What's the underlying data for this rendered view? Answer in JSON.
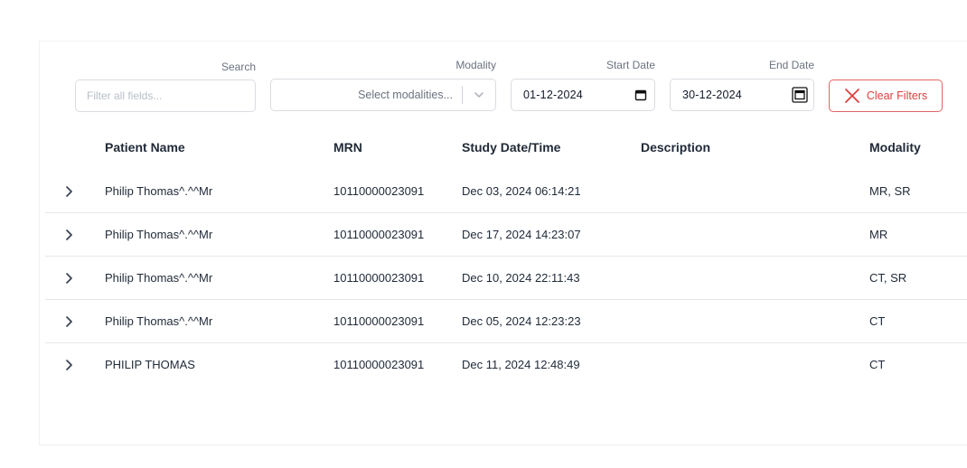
{
  "filters": {
    "search": {
      "label": "Search",
      "placeholder": "Filter all fields...",
      "value": ""
    },
    "modality": {
      "label": "Modality",
      "placeholder": "Select modalities..."
    },
    "start_date": {
      "label": "Start Date",
      "value": "01-12-2024"
    },
    "end_date": {
      "label": "End Date",
      "value": "30-12-2024"
    },
    "clear_label": "Clear Filters"
  },
  "table": {
    "columns": {
      "patient_name": "Patient Name",
      "mrn": "MRN",
      "study_datetime": "Study Date/Time",
      "description": "Description",
      "modality": "Modality"
    },
    "rows": [
      {
        "patient_name": "Philip Thomas^.^^Mr",
        "mrn": "10110000023091",
        "study_datetime": "Dec 03, 2024 06:14:21",
        "description": "",
        "modality": "MR, SR"
      },
      {
        "patient_name": "Philip Thomas^.^^Mr",
        "mrn": "10110000023091",
        "study_datetime": "Dec 17, 2024 14:23:07",
        "description": "",
        "modality": "MR"
      },
      {
        "patient_name": "Philip Thomas^.^^Mr",
        "mrn": "10110000023091",
        "study_datetime": "Dec 10, 2024 22:11:43",
        "description": "",
        "modality": "CT, SR"
      },
      {
        "patient_name": "Philip Thomas^.^^Mr",
        "mrn": "10110000023091",
        "study_datetime": "Dec 05, 2024 12:23:23",
        "description": "",
        "modality": "CT"
      },
      {
        "patient_name": "PHILIP THOMAS",
        "mrn": "10110000023091",
        "study_datetime": "Dec 11, 2024 12:48:49",
        "description": "",
        "modality": "CT"
      }
    ]
  },
  "icons": {
    "expand": "chevron-right-icon",
    "select": "chevron-down-icon",
    "calendar": "calendar-icon",
    "clear": "close-icon"
  },
  "colors": {
    "danger": "#dc3f3f",
    "border": "#d9dce1",
    "text": "#1f2937",
    "muted": "#6b7280"
  }
}
